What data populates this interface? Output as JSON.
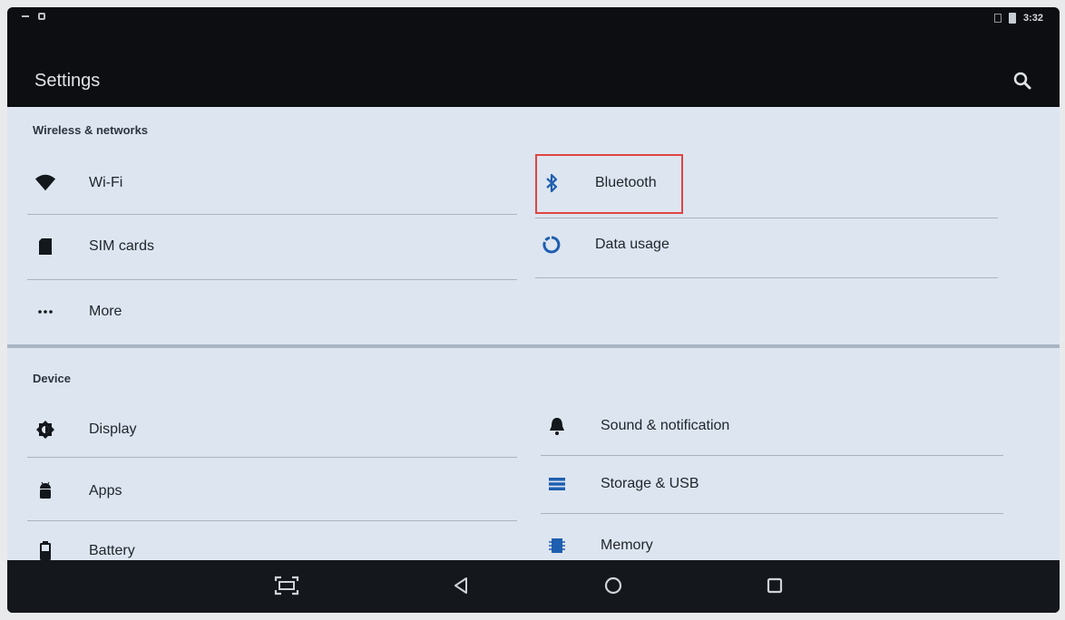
{
  "status_bar": {
    "time": "3:32"
  },
  "toolbar": {
    "title": "Settings",
    "search_icon": "search-icon"
  },
  "sections": {
    "wireless": {
      "header": "Wireless & networks",
      "items": [
        {
          "label": "Wi-Fi",
          "icon": "wifi-icon"
        },
        {
          "label": "Bluetooth",
          "icon": "bluetooth-icon"
        },
        {
          "label": "SIM cards",
          "icon": "sim-card-icon"
        },
        {
          "label": "Data usage",
          "icon": "data-usage-icon"
        },
        {
          "label": "More",
          "icon": "more-icon"
        }
      ]
    },
    "device": {
      "header": "Device",
      "items": [
        {
          "label": "Display",
          "icon": "display-icon"
        },
        {
          "label": "Sound & notification",
          "icon": "bell-icon"
        },
        {
          "label": "Apps",
          "icon": "android-icon"
        },
        {
          "label": "Storage & USB",
          "icon": "storage-icon"
        },
        {
          "label": "Battery",
          "icon": "battery-icon"
        },
        {
          "label": "Memory",
          "icon": "memory-icon"
        }
      ]
    }
  },
  "nav_bar": {
    "buttons": [
      "screenshot-icon",
      "back-icon",
      "home-icon",
      "recents-icon"
    ]
  },
  "colors": {
    "accent_icon": "#1e5fb0",
    "highlight_box": "#e04343",
    "content_background": "#dde5f0",
    "toolbar_background": "#0c0e12"
  }
}
